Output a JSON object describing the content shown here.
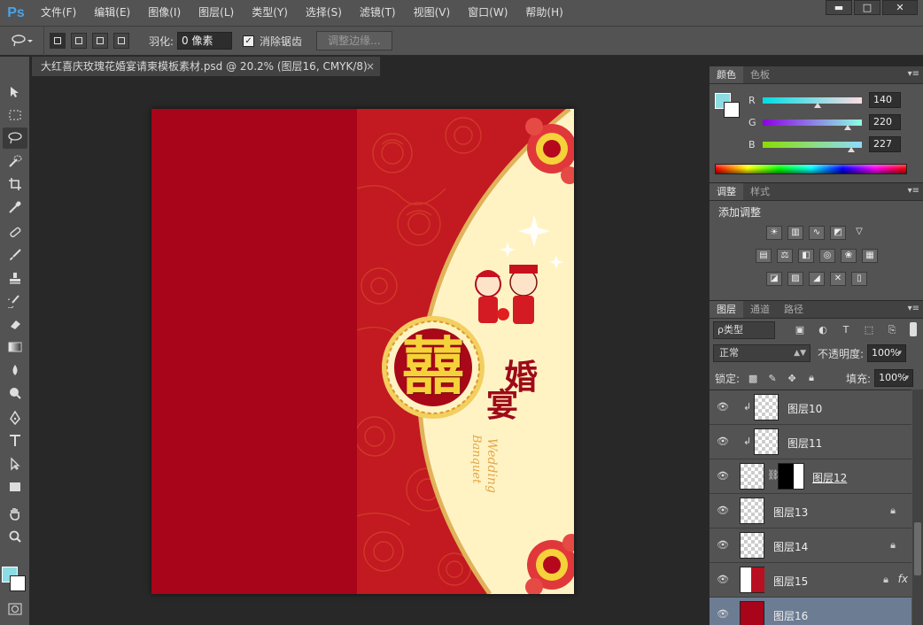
{
  "app": {
    "logo": "Ps"
  },
  "menu": [
    "文件(F)",
    "编辑(E)",
    "图像(I)",
    "图层(L)",
    "类型(Y)",
    "选择(S)",
    "滤镜(T)",
    "视图(V)",
    "窗口(W)",
    "帮助(H)"
  ],
  "window_controls": {
    "minimize": "▬",
    "maximize": "□",
    "close": "✕"
  },
  "options_bar": {
    "feather_label": "羽化:",
    "feather_value": "0 像素",
    "antialias_label": "消除锯齿",
    "antialias_checked": "✓",
    "refine_edge_label": "调整边缘..."
  },
  "document": {
    "tab_title": "大红喜庆玫瑰花婚宴请柬模板素材.psd @ 20.2% (图层16, CMYK/8)",
    "tab_close": "×"
  },
  "artwork": {
    "double_happiness": "囍",
    "title_chars": [
      "婚",
      "宴"
    ],
    "english_line1": "Wedding",
    "english_line2": "Banquet"
  },
  "colors": {
    "foreground": "#8cdce3",
    "background": "#ffffff",
    "invite_red": "#a8041a",
    "invite_cream": "#fff3c4",
    "gold": "#f5d23a",
    "selected_layer": "#6c7c92"
  },
  "color_panel": {
    "tabs": [
      "颜色",
      "色板"
    ],
    "channels": [
      {
        "label": "R",
        "value": "140"
      },
      {
        "label": "G",
        "value": "220"
      },
      {
        "label": "B",
        "value": "227"
      }
    ]
  },
  "adjustments_panel": {
    "tabs": [
      "调整",
      "样式"
    ],
    "title": "添加调整",
    "icons": [
      [
        "brightness-contrast-icon",
        "levels-icon",
        "curves-icon",
        "exposure-icon",
        "gradient-map-triangle-icon"
      ],
      [
        "vibrance-icon",
        "balance-icon",
        "black-white-icon",
        "photo-filter-icon",
        "channel-mixer-icon",
        "color-lookup-icon"
      ],
      [
        "invert-icon",
        "posterize-icon",
        "threshold-icon",
        "selective-color-icon",
        "gradient-icon"
      ]
    ]
  },
  "layers_panel": {
    "tabs": [
      "图层",
      "通道",
      "路径"
    ],
    "filter_kind": "ρ类型",
    "blend_mode": "正常",
    "opacity_label": "不透明度:",
    "opacity_value": "100%",
    "lock_label": "锁定:",
    "fill_label": "填充:",
    "fill_value": "100%",
    "layers": [
      {
        "name": "图层10",
        "clipped": true,
        "locked": false,
        "fx": false,
        "selected": false
      },
      {
        "name": "图层11",
        "clipped": true,
        "locked": false,
        "fx": false,
        "selected": false
      },
      {
        "name": "图层12",
        "clipped": false,
        "locked": false,
        "fx": false,
        "selected": false,
        "mask": true
      },
      {
        "name": "图层13",
        "clipped": false,
        "locked": true,
        "fx": false,
        "selected": false
      },
      {
        "name": "图层14",
        "clipped": false,
        "locked": true,
        "fx": false,
        "selected": false
      },
      {
        "name": "图层15",
        "clipped": false,
        "locked": true,
        "fx": true,
        "selected": false
      },
      {
        "name": "图层16",
        "clipped": false,
        "locked": false,
        "fx": false,
        "selected": true
      }
    ],
    "fx_label": "fx"
  }
}
